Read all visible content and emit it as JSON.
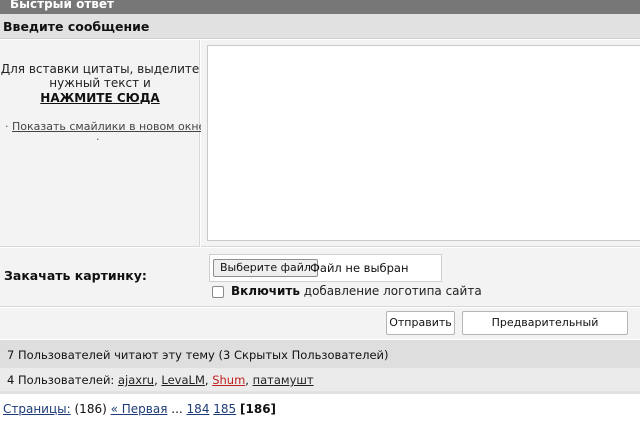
{
  "header": {
    "title": "Быстрый ответ"
  },
  "form": {
    "section_title": "Введите сообщение",
    "quote_hint_line1": "Для вставки цитаты, выделите",
    "quote_hint_line2": "нужный текст и",
    "quote_link": "НАЖМИТЕ СЮДА",
    "smiles_bullet": "·",
    "smiles_link": "Показать смайлики в новом окне",
    "smiles_trailing_dot": "·",
    "message_value": "",
    "upload_label": "Закачать картинку:",
    "file_button": "Выберите файл",
    "file_status": "Файл не выбран",
    "logo_checkbox_checked": false,
    "logo_label_bold": "Включить",
    "logo_label_rest": "добавление логотипа сайта",
    "send_button": "Отправить",
    "preview_button": "Предварительный просмотр"
  },
  "readers": {
    "summary": "7 Пользователей читают эту тему (3 Скрытых Пользователей)",
    "users_prefix": "4 Пользователей:",
    "users": [
      {
        "name": "ajaxru",
        "color": "#222222"
      },
      {
        "name": "LevaLM",
        "color": "#222222"
      },
      {
        "name": "Shum",
        "color": "#c02020"
      },
      {
        "name": "патамушт",
        "color": "#222222"
      }
    ],
    "separator": ","
  },
  "pager": {
    "label": "Страницы:",
    "total": "(186)",
    "first": "« Первая",
    "ellipsis": "...",
    "pages": [
      "184",
      "185"
    ],
    "current": "[186]"
  },
  "colors": {
    "header_bg": "#777777",
    "subheader_bg": "#e1e1e1",
    "panel_bg": "#f3f3f3",
    "link_blue": "#1d3b78",
    "highlight_red": "#c02020"
  }
}
